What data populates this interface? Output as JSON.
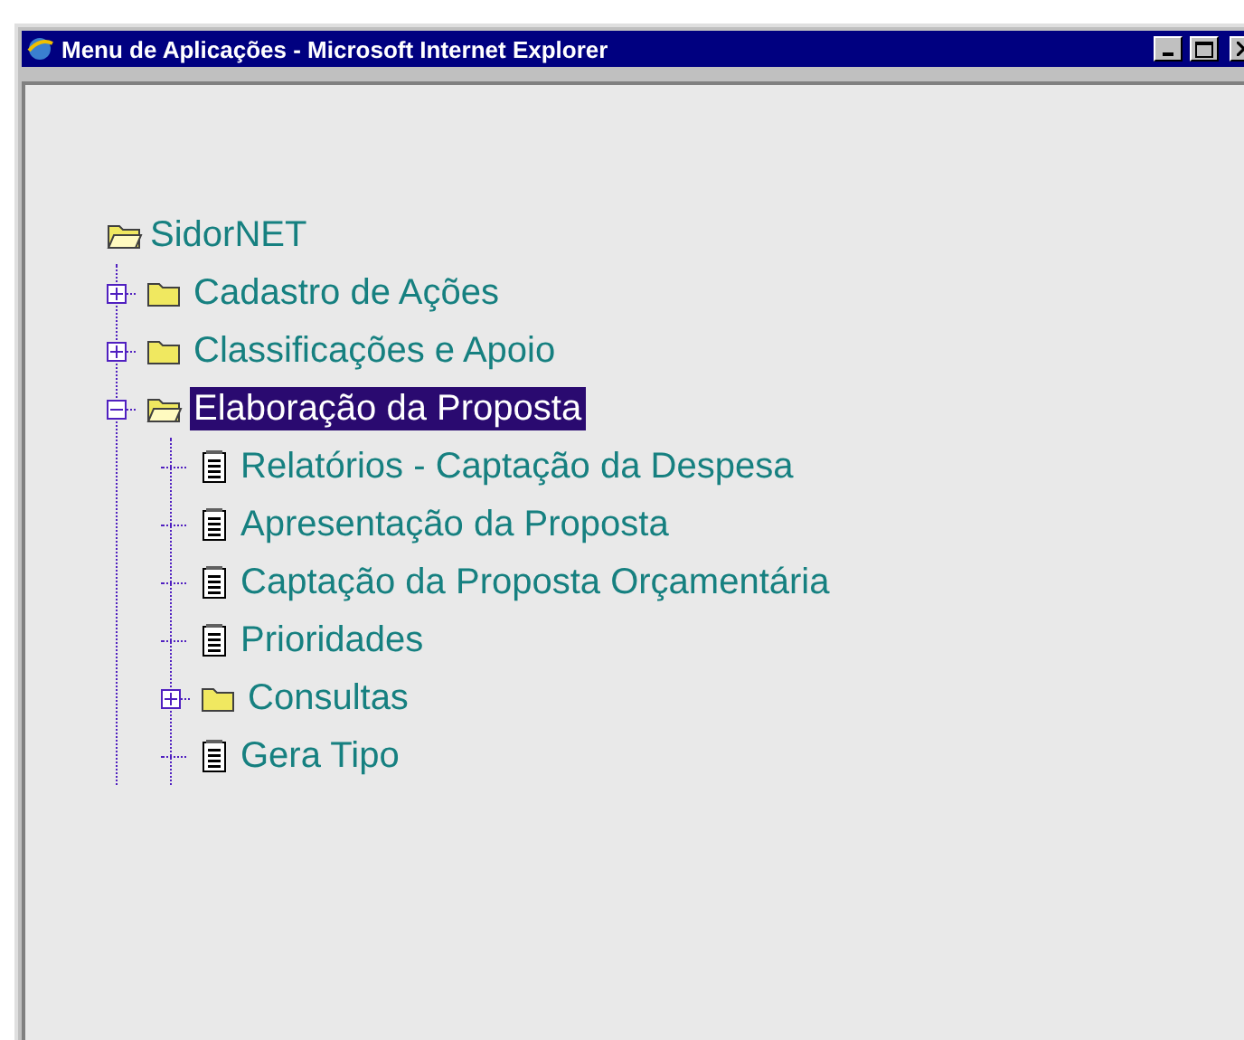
{
  "window": {
    "title": "Menu de Aplicações - Microsoft Internet Explorer"
  },
  "tree": {
    "label": "SidorNET",
    "kind": "folder",
    "expanded": true,
    "selected": false,
    "children": [
      {
        "label": "Cadastro de Ações",
        "kind": "folder",
        "expanded": false,
        "selected": false
      },
      {
        "label": "Classificações e Apoio",
        "kind": "folder",
        "expanded": false,
        "selected": false
      },
      {
        "label": "Elaboração da Proposta",
        "kind": "folder",
        "expanded": true,
        "selected": true,
        "children": [
          {
            "label": "Relatórios - Captação da Despesa",
            "kind": "document",
            "selected": false
          },
          {
            "label": "Apresentação da Proposta",
            "kind": "document",
            "selected": false
          },
          {
            "label": "Captação da Proposta Orçamentária",
            "kind": "document",
            "selected": false
          },
          {
            "label": "Prioridades",
            "kind": "document",
            "selected": false
          },
          {
            "label": "Consultas",
            "kind": "folder",
            "expanded": false,
            "selected": false
          },
          {
            "label": "Gera Tipo",
            "kind": "document",
            "selected": false
          }
        ]
      }
    ]
  }
}
